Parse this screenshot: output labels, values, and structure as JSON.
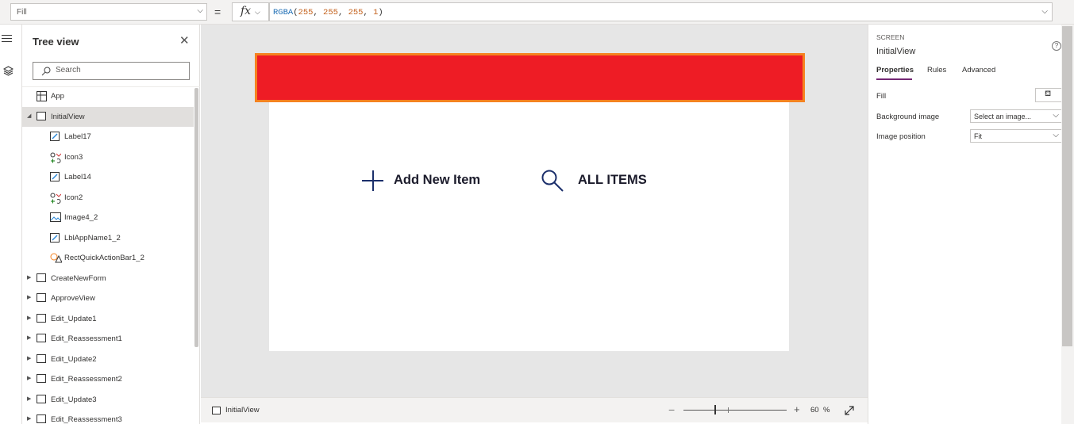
{
  "formula_bar": {
    "property": "Fill",
    "fx_label": "fx",
    "formula_fn": "RGBA",
    "formula_open": "(",
    "formula_args": [
      "255",
      "255",
      "255",
      "1"
    ],
    "formula_close": ")"
  },
  "tree_view": {
    "title": "Tree view",
    "search_placeholder": "Search",
    "items": [
      {
        "label": "App",
        "indent": 0,
        "icon": "app-icon"
      },
      {
        "label": "InitialView",
        "indent": 0,
        "icon": "screen-icon",
        "expanded": true,
        "selected": true
      },
      {
        "label": "Label17",
        "indent": 1,
        "icon": "label-icon"
      },
      {
        "label": "Icon3",
        "indent": 1,
        "icon": "icon-control-icon"
      },
      {
        "label": "Label14",
        "indent": 1,
        "icon": "label-icon"
      },
      {
        "label": "Icon2",
        "indent": 1,
        "icon": "icon-control-icon"
      },
      {
        "label": "Image4_2",
        "indent": 1,
        "icon": "image-icon"
      },
      {
        "label": "LblAppName1_2",
        "indent": 1,
        "icon": "label-icon"
      },
      {
        "label": "RectQuickActionBar1_2",
        "indent": 1,
        "icon": "shape-icon"
      },
      {
        "label": "CreateNewForm",
        "indent": 0,
        "icon": "screen-icon",
        "expanded": false
      },
      {
        "label": "ApproveView",
        "indent": 0,
        "icon": "screen-icon",
        "expanded": false
      },
      {
        "label": "Edit_Update1",
        "indent": 0,
        "icon": "screen-icon",
        "expanded": false
      },
      {
        "label": "Edit_Reassessment1",
        "indent": 0,
        "icon": "screen-icon",
        "expanded": false
      },
      {
        "label": "Edit_Update2",
        "indent": 0,
        "icon": "screen-icon",
        "expanded": false
      },
      {
        "label": "Edit_Reassessment2",
        "indent": 0,
        "icon": "screen-icon",
        "expanded": false
      },
      {
        "label": "Edit_Update3",
        "indent": 0,
        "icon": "screen-icon",
        "expanded": false
      },
      {
        "label": "Edit_Reassessment3",
        "indent": 0,
        "icon": "screen-icon",
        "expanded": false
      }
    ]
  },
  "canvas": {
    "add_label": "Add New Item",
    "all_label": "ALL ITEMS",
    "header_color": "#ee1c25",
    "selection_color": "#f58220",
    "icon_color": "#1b2f6b"
  },
  "status_bar": {
    "screen_name": "InitialView",
    "zoom_value": "60",
    "zoom_unit": "%"
  },
  "properties": {
    "kind": "SCREEN",
    "name": "InitialView",
    "tabs": [
      "Properties",
      "Rules",
      "Advanced"
    ],
    "fill_label": "Fill",
    "bg_image_label": "Background image",
    "bg_image_value": "Select an image...",
    "image_position_label": "Image position",
    "image_position_value": "Fit",
    "accent_color": "#742774"
  }
}
